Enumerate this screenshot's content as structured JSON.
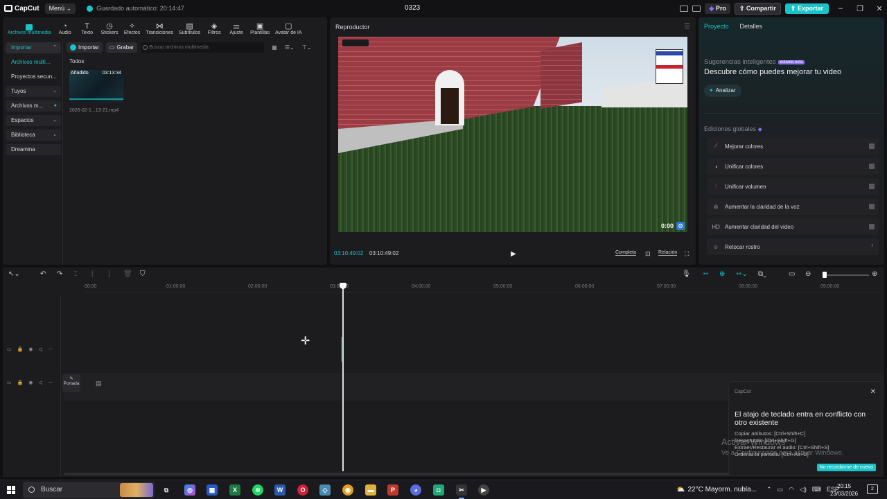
{
  "titlebar": {
    "logo": "CapCut",
    "menu": "Menú",
    "autosave": "Guardado automático: 20:14:47",
    "project_name": "0323",
    "pro": "Pro",
    "share": "Compartir",
    "export": "Exportar"
  },
  "toolbar": {
    "items": [
      "Archivos multimedia",
      "Audio",
      "Texto",
      "Stickers",
      "Efectos",
      "Transiciones",
      "Subtítulos",
      "Filtros",
      "Ajuste",
      "Plantillas",
      "Avatar de IA"
    ],
    "icons": [
      "media-icon",
      "audio-icon",
      "text-icon",
      "stickers-icon",
      "effects-icon",
      "transitions-icon",
      "subtitles-icon",
      "filters-icon",
      "adjust-icon",
      "templates-icon",
      "ai-avatar-icon"
    ]
  },
  "sidenav": {
    "import": "Importar",
    "media_files": "Archivos multi...",
    "secondary_projects": "Proyectos secun...",
    "yours": "Tuyos",
    "media_m": "Archivos m...",
    "spaces": "Espacios",
    "library": "Biblioteca",
    "dreamina": "Dreamina"
  },
  "media": {
    "import_btn": "Importar",
    "record_btn": "Grabar",
    "search_placeholder": "Buscar archivos multimedia",
    "all_label": "Todos",
    "thumb_tag": "Añadido",
    "thumb_duration": "03:13:34",
    "file_name": "2026-02-1...13-21.mp4"
  },
  "player": {
    "title": "Reproductor",
    "current_time": "03:10:49:02",
    "total_time": "03:10:49:02",
    "full": "Completa",
    "ratio": "Relación",
    "hud_time": "0:00"
  },
  "right_panel": {
    "tab_project": "Proyecto",
    "tab_details": "Detalles",
    "suggestions": "Sugerencias inteligentes",
    "badge": "estante esta",
    "headline": "Descubre cómo puedes mejorar tu video",
    "analyze": "Analizar",
    "global_edits": "Ediciones globales",
    "edits": [
      {
        "label": "Mejorar colores",
        "icon": "wand-icon"
      },
      {
        "label": "Unificar colores",
        "icon": "palette-icon"
      },
      {
        "label": "Unificar volumen",
        "icon": "equalizer-icon"
      },
      {
        "label": "Aumentar la claridad de la voz",
        "icon": "waveform-icon"
      },
      {
        "label": "Aumentar claridad del video",
        "icon": "hd-icon"
      },
      {
        "label": "Retocar rostro",
        "icon": "face-icon"
      }
    ]
  },
  "timeline": {
    "ruler": [
      "00:00",
      "01:00:00",
      "02:00:00",
      "03:00:00",
      "04:00:00",
      "05:00:00",
      "06:00:00",
      "07:00:00",
      "08:00:00",
      "09:00:00"
    ],
    "cover": "Portada"
  },
  "toast": {
    "app": "CapCut",
    "title": "El atajo de teclado entra en conflicto con otro existente",
    "lines": [
      "Copiar atributos: [Ctrl+Shift+C]",
      "Desagrupar: [Ctrl+Shift+G]",
      "Extraer/Restaurar el audio: [Ctrl+Shift+S]",
      "Ordenar la pantalla: [Ctrl+Alt+D]"
    ],
    "dismiss": "No recordarme de nuevo"
  },
  "watermark": {
    "line1": "Activar Windows",
    "line2": "Ve a Configuración para activar Windows."
  },
  "taskbar": {
    "search": "Buscar",
    "weather": "22°C  Mayorm. nubla...",
    "lang": "ESP",
    "time": "20:15",
    "date": "23/03/2026",
    "notif_count": "2"
  }
}
